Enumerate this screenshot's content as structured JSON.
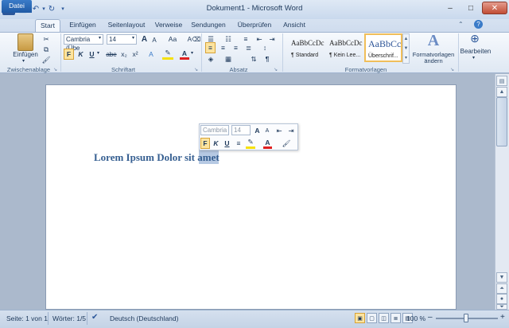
{
  "window": {
    "title": "Dokument1 - Microsoft Word",
    "app_icon_letter": "W",
    "quick_access": [
      "save-icon",
      "undo-icon",
      "redo-icon",
      "customize-icon"
    ],
    "controls": {
      "minimize": "–",
      "maximize": "□",
      "close": "✕"
    }
  },
  "tabs": [
    "Datei",
    "Start",
    "Einfügen",
    "Seitenlayout",
    "Verweise",
    "Sendungen",
    "Überprüfen",
    "Ansicht"
  ],
  "active_tab": "Start",
  "ribbon": {
    "clipboard": {
      "paste_label": "Einfügen",
      "group": "Zwischenablage"
    },
    "font": {
      "family": "Cambria (Übe",
      "size": "14",
      "group": "Schriftart",
      "bold": "F",
      "italic": "K",
      "underline": "U",
      "strike": "abe",
      "sub": "x₂",
      "sup": "x²",
      "grow": "A",
      "shrink": "A",
      "case": "Aa",
      "color_letter": "A"
    },
    "paragraph": {
      "group": "Absatz",
      "pilcrow": "¶"
    },
    "styles": {
      "group": "Formatvorlagen",
      "items": [
        {
          "sample": "AaBbCcDc",
          "name": "¶ Standard"
        },
        {
          "sample": "AaBbCcDc",
          "name": "¶ Kein Lee..."
        },
        {
          "sample": "AaBbCc",
          "name": "Überschrif..."
        }
      ],
      "change_styles_label": "Formatvorlagen ändern"
    },
    "editing": {
      "label": "Bearbeiten"
    }
  },
  "mini_toolbar": {
    "font": "Cambria",
    "size": "14",
    "bold": "F",
    "italic": "K",
    "underline": "U"
  },
  "document": {
    "heading": "Lorem Ipsum Dolor sit amet"
  },
  "status": {
    "page": "Seite: 1 von 1",
    "words": "Wörter: 1/5",
    "language": "Deutsch (Deutschland)",
    "zoom": "100 %",
    "zoom_minus": "–",
    "zoom_plus": "+"
  },
  "colors": {
    "accent": "#2b579a",
    "heading": "#365f91",
    "highlight": "#fde49f"
  }
}
